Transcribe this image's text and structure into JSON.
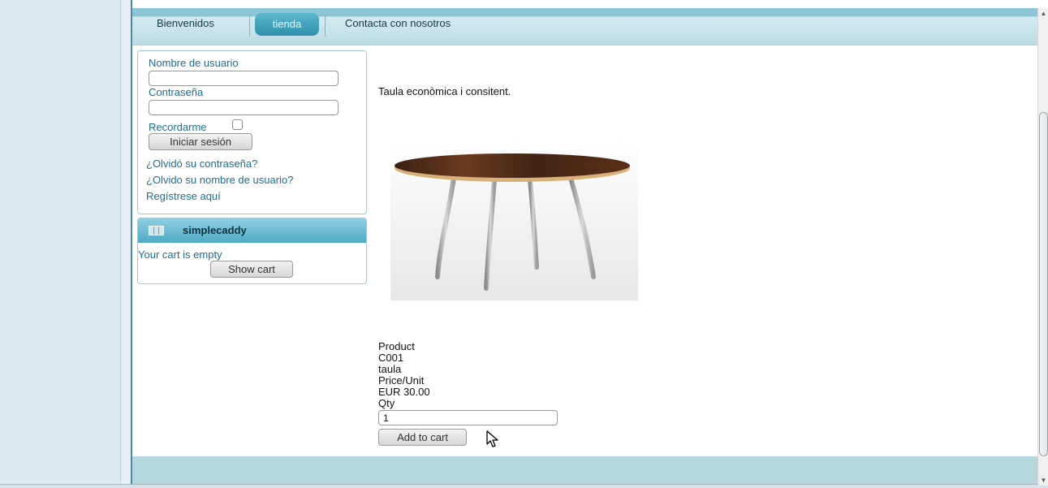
{
  "nav": {
    "items": [
      {
        "label": "Bienvenidos"
      },
      {
        "label": "tienda",
        "active": true
      },
      {
        "label": "Contacta con nosotros"
      }
    ]
  },
  "login": {
    "username_label": "Nombre de usuario",
    "username_value": "",
    "password_label": "Contraseña",
    "password_value": "",
    "remember_label": "Recordarme",
    "login_button": "Iniciar sesión",
    "forgot_password": "¿Olvidó su contraseña?",
    "forgot_username": "¿Olvido su nombre de usuario?",
    "register": "Regístrese aquí"
  },
  "cart": {
    "title": "simplecaddy",
    "empty_text": "Your cart is empty",
    "show_button": "Show cart"
  },
  "product": {
    "description": "Taula econòmica i consitent.",
    "image_icon": "round-table-image",
    "product_label": "Product",
    "code": "C001",
    "name": "taula",
    "price_label": "Price/Unit",
    "price": "EUR 30.00",
    "qty_label": "Qty",
    "qty_value": "1",
    "add_button": "Add to cart"
  },
  "colors": {
    "nav_active": "#3a9ab7",
    "link": "#1c6e92",
    "header_bar": "#bcdbe5"
  }
}
